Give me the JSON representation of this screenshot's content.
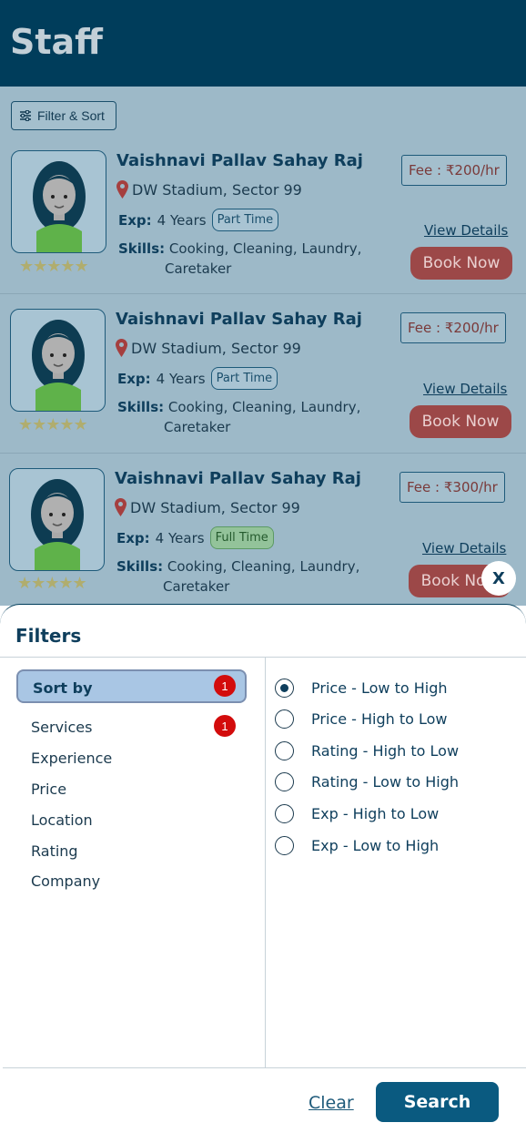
{
  "header": {
    "title": "Staff"
  },
  "toolbar": {
    "filter_label": "Filter & Sort"
  },
  "staff": [
    {
      "name": "Vaishnavi Pallav Sahay Raj",
      "location": "DW Stadium, Sector 99",
      "exp_label": "Exp:",
      "exp_value": "4 Years",
      "type": "Part Time",
      "skills_label": "Skills:",
      "skills_line1": "Cooking, Cleaning, Laundry,",
      "skills_line2": "Caretaker",
      "fee": "Fee : ₹200/hr",
      "rating_stars": "★★★★★",
      "rating": 5,
      "view_label": "View Details",
      "book_label": "Book Now"
    },
    {
      "name": "Vaishnavi Pallav Sahay Raj",
      "location": "DW Stadium, Sector 99",
      "exp_label": "Exp:",
      "exp_value": "4 Years",
      "type": "Part Time",
      "skills_label": "Skills:",
      "skills_line1": "Cooking, Cleaning, Laundry,",
      "skills_line2": "Caretaker",
      "fee": "Fee : ₹200/hr",
      "rating_stars": "★★★★★",
      "rating": 5,
      "view_label": "View Details",
      "book_label": "Book Now"
    },
    {
      "name": "Vaishnavi Pallav Sahay Raj",
      "location": "DW Stadium, Sector 99",
      "exp_label": "Exp:",
      "exp_value": "4 Years",
      "type": "Full Time",
      "skills_label": "Skills:",
      "skills_line1": "Cooking, Cleaning, Laundry,",
      "skills_line2": "Caretaker",
      "fee": "Fee : ₹300/hr",
      "rating_stars": "★★★★★",
      "rating": 5,
      "view_label": "View Details",
      "book_label": "Book Now"
    }
  ],
  "close_label": "X",
  "filters": {
    "title": "Filters",
    "categories": [
      {
        "label": "Sort by",
        "badge": "1",
        "active": true
      },
      {
        "label": "Services",
        "badge": "1"
      },
      {
        "label": "Experience"
      },
      {
        "label": "Price"
      },
      {
        "label": "Location"
      },
      {
        "label": "Rating"
      },
      {
        "label": "Company"
      }
    ],
    "sort_options": [
      {
        "label": "Price - Low to High",
        "selected": true
      },
      {
        "label": "Price - High to Low"
      },
      {
        "label": "Rating - High to Low"
      },
      {
        "label": "Rating - Low to High"
      },
      {
        "label": "Exp - High to Low"
      },
      {
        "label": "Exp - Low to High"
      }
    ],
    "clear_label": "Clear",
    "search_label": "Search"
  },
  "colors": {
    "header_bg": "#003d5b",
    "overlay_bg": "#9db9c8",
    "book_button": "#9c4848",
    "search_button": "#0a5a80",
    "badge": "#d30c0c"
  }
}
